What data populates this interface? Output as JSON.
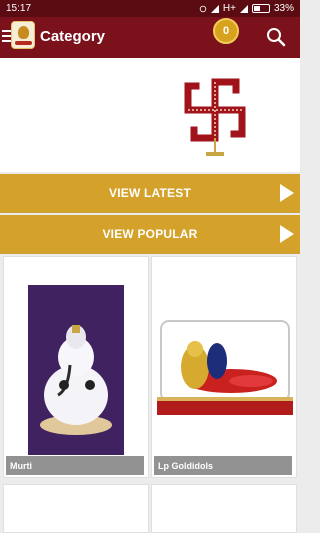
{
  "status_bar": {
    "time": "15:17",
    "network": "H+",
    "battery_percent": "33%"
  },
  "header": {
    "title": "Category",
    "cart_count": "0"
  },
  "buttons": {
    "view_latest": "VIEW LATEST",
    "view_popular": "VIEW POPULAR"
  },
  "categories": [
    {
      "label": "Murti"
    },
    {
      "label": "Lp Goldidols"
    }
  ],
  "colors": {
    "status_bar": "#5b0c12",
    "app_bar": "#7b121b",
    "accent_gold": "#d4a12a",
    "label_gray": "#929292"
  },
  "icons": [
    "menu-icon",
    "logo",
    "cart-icon",
    "search-icon",
    "chevron-right-icon"
  ]
}
